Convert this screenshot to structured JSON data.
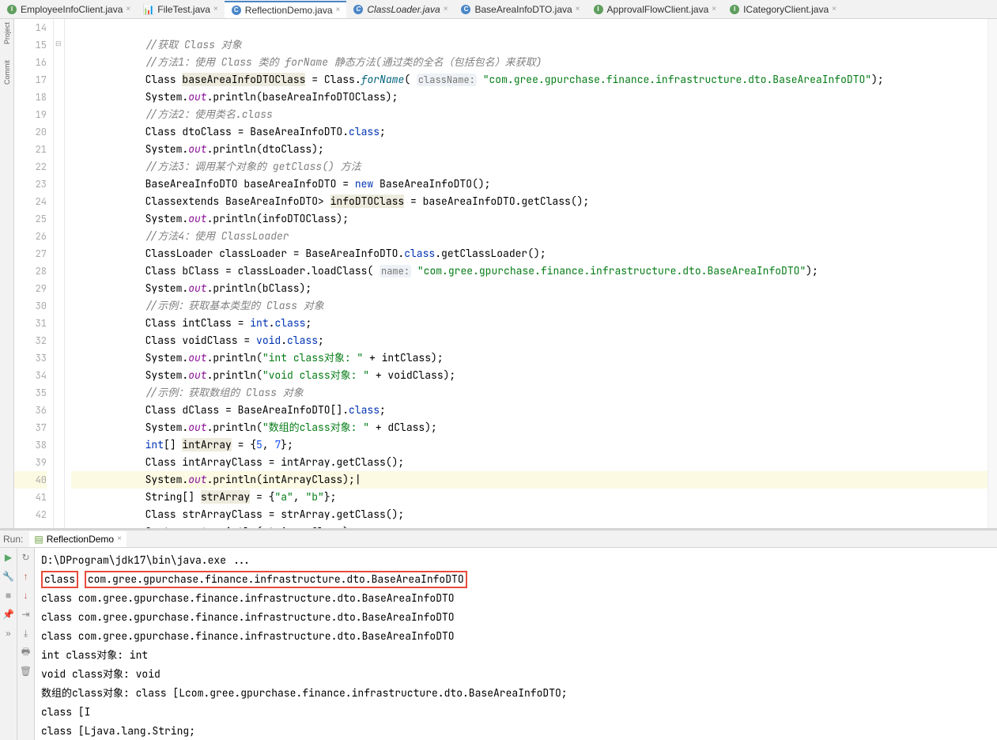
{
  "tabs": [
    {
      "icon": "I",
      "label": "EmployeeInfoClient.java",
      "iconClass": "icon-i",
      "close": true
    },
    {
      "icon": "F",
      "label": "FileTest.java",
      "iconClass": "icon-file",
      "close": true
    },
    {
      "icon": "C",
      "label": "ReflectionDemo.java",
      "iconClass": "icon-c",
      "active": true,
      "close": true
    },
    {
      "icon": "C",
      "label": "ClassLoader.java",
      "iconClass": "icon-c",
      "italic": true,
      "close": true
    },
    {
      "icon": "C",
      "label": "BaseAreaInfoDTO.java",
      "iconClass": "icon-c",
      "close": true
    },
    {
      "icon": "I",
      "label": "ApprovalFlowClient.java",
      "iconClass": "icon-i",
      "close": true
    },
    {
      "icon": "I",
      "label": "ICategoryClient.java",
      "iconClass": "icon-i",
      "close": true
    }
  ],
  "lineStart": 14,
  "lineEnd": 43,
  "code": {
    "l15": "//获取 Class 对象",
    "l16": "//方法1：使用 Class 类的 forName 静态方法(通过类的全名（包括包名）来获取)",
    "l17_a": "Class<?> ",
    "l17_var": "baseAreaInfoDTOClass",
    "l17_b": " = Class.",
    "l17_m": "forName",
    "l17_c": "( ",
    "l17_hint": "className:",
    "l17_str": "\"com.gree.gpurchase.finance.infrastructure.dto.BaseAreaInfoDTO\"",
    "l17_d": ");",
    "l18_a": "System.",
    "l18_out": "out",
    "l18_b": ".println(baseAreaInfoDTOClass);",
    "l19": "//方法2：使用类名.class",
    "l20_a": "Class<BaseAreaInfoDTO> dtoClass = BaseAreaInfoDTO.",
    "l20_kw": "class",
    "l20_b": ";",
    "l21_a": "System.",
    "l21_out": "out",
    "l21_b": ".println(dtoClass);",
    "l22": "//方法3：调用某个对象的 getClass() 方法",
    "l23_a": "BaseAreaInfoDTO baseAreaInfoDTO = ",
    "l23_kw": "new",
    "l23_b": " BaseAreaInfoDTO();",
    "l24_a": "Class<? ",
    "l24_kw": "extends",
    "l24_b": " BaseAreaInfoDTO> ",
    "l24_var": "infoDTOClass",
    "l24_c": " = baseAreaInfoDTO.getClass();",
    "l25_a": "System.",
    "l25_out": "out",
    "l25_b": ".println(infoDTOClass);",
    "l26": "//方法4：使用 ClassLoader",
    "l27": "ClassLoader classLoader = BaseAreaInfoDTO.",
    "l27_kw": "class",
    "l27_b": ".getClassLoader();",
    "l28_a": "Class<?> bClass = classLoader.loadClass( ",
    "l28_hint": "name:",
    "l28_str": "\"com.gree.gpurchase.finance.infrastructure.dto.BaseAreaInfoDTO\"",
    "l28_b": ");",
    "l29_a": "System.",
    "l29_out": "out",
    "l29_b": ".println(bClass);",
    "l30": "//示例：获取基本类型的 Class 对象",
    "l31_a": "Class<?> intClass = ",
    "l31_kw": "int",
    "l31_b": ".",
    "l31_kw2": "class",
    "l31_c": ";",
    "l32_a": "Class<?> voidClass = ",
    "l32_kw": "void",
    "l32_b": ".",
    "l32_kw2": "class",
    "l32_c": ";",
    "l33_a": "System.",
    "l33_out": "out",
    "l33_b": ".println(",
    "l33_str": "\"int class对象: \"",
    "l33_c": " + intClass);",
    "l34_a": "System.",
    "l34_out": "out",
    "l34_b": ".println(",
    "l34_str": "\"void class对象: \"",
    "l34_c": " + voidClass);",
    "l35": "//示例：获取数组的 Class 对象",
    "l36_a": "Class<BaseAreaInfoDTO[]> dClass = BaseAreaInfoDTO[].",
    "l36_kw": "class",
    "l36_b": ";",
    "l37_a": "System.",
    "l37_out": "out",
    "l37_b": ".println(",
    "l37_str": "\"数组的class对象: \"",
    "l37_c": " + dClass);",
    "l38_a": "",
    "l38_kw": "int",
    "l38_b": "[] ",
    "l38_var": "intArray",
    "l38_c": " = {",
    "l38_n1": "5",
    "l38_d": ", ",
    "l38_n2": "7",
    "l38_e": "};",
    "l39_a": "Class<?> intArrayClass = intArray.getClass();",
    "l40_a": "System.",
    "l40_out": "out",
    "l40_b": ".println(intArrayClass);",
    "l41_a": "String[] ",
    "l41_var": "strArray",
    "l41_b": " = {",
    "l41_s1": "\"a\"",
    "l41_c": ", ",
    "l41_s2": "\"b\"",
    "l41_d": "};",
    "l42_a": "Class<?> strArrayClass = strArray.getClass();",
    "l43_a": "System.",
    "l43_out": "out",
    "l43_b": ".println(strArrayClass);"
  },
  "run": {
    "label": "Run:",
    "tab": "ReflectionDemo",
    "out": [
      "D:\\DProgram\\jdk17\\bin\\java.exe ...",
      {
        "boxed": [
          "class",
          "com.gree.gpurchase.finance.infrastructure.dto.BaseAreaInfoDTO"
        ]
      },
      "class com.gree.gpurchase.finance.infrastructure.dto.BaseAreaInfoDTO",
      "class com.gree.gpurchase.finance.infrastructure.dto.BaseAreaInfoDTO",
      "class com.gree.gpurchase.finance.infrastructure.dto.BaseAreaInfoDTO",
      "int class对象: int",
      "void class对象: void",
      "数组的class对象: class [Lcom.gree.gpurchase.finance.infrastructure.dto.BaseAreaInfoDTO;",
      "class [I",
      "class [Ljava.lang.String;"
    ]
  }
}
